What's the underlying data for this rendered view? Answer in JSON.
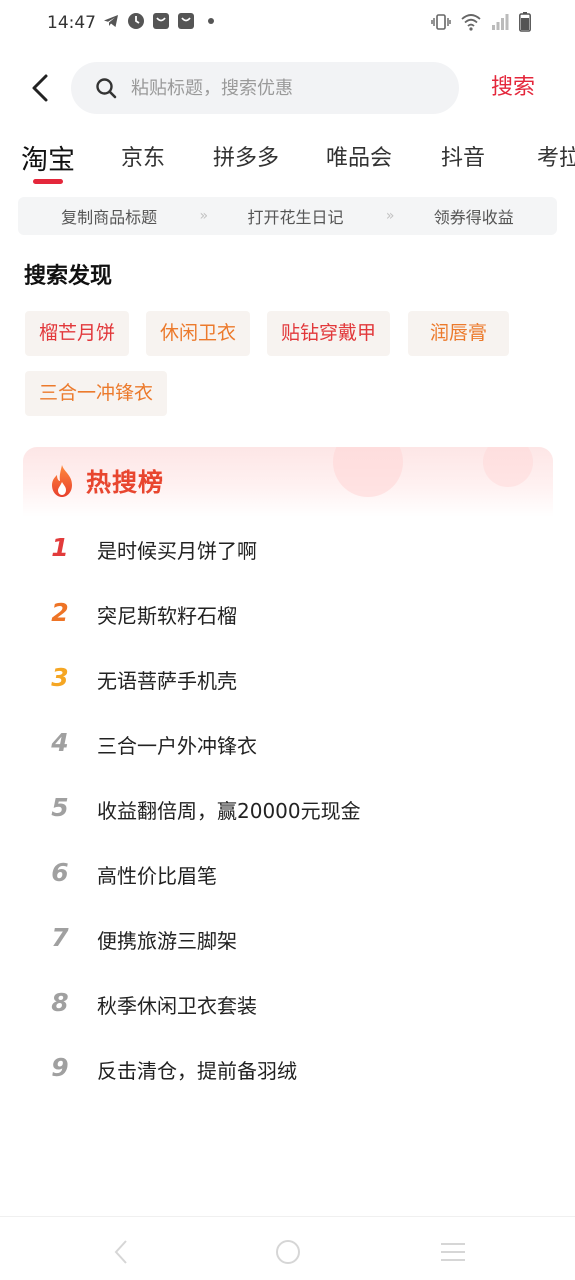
{
  "status_bar": {
    "time": "14:47"
  },
  "search": {
    "placeholder": "粘贴标题，搜索优惠",
    "button_label": "搜索"
  },
  "tabs": [
    {
      "label": "淘宝",
      "active": true
    },
    {
      "label": "京东"
    },
    {
      "label": "拼多多"
    },
    {
      "label": "唯品会"
    },
    {
      "label": "抖音"
    },
    {
      "label": "考拉"
    }
  ],
  "steps": [
    "复制商品标题",
    "打开花生日记",
    "领券得收益"
  ],
  "step_separator": "»",
  "discover": {
    "title": "搜索发现",
    "tags": [
      "榴芒月饼",
      "休闲卫衣",
      "贴钻穿戴甲",
      "润唇膏",
      "三合一冲锋衣"
    ]
  },
  "hot": {
    "title": "热搜榜",
    "items": [
      {
        "rank": "1",
        "text": "是时候买月饼了啊"
      },
      {
        "rank": "2",
        "text": "突尼斯软籽石榴"
      },
      {
        "rank": "3",
        "text": "无语菩萨手机壳"
      },
      {
        "rank": "4",
        "text": "三合一户外冲锋衣"
      },
      {
        "rank": "5",
        "text": "收益翻倍周，赢20000元现金"
      },
      {
        "rank": "6",
        "text": "高性价比眉笔"
      },
      {
        "rank": "7",
        "text": "便携旅游三脚架"
      },
      {
        "rank": "8",
        "text": "秋季休闲卫衣套装"
      },
      {
        "rank": "9",
        "text": "反击清仓，提前备羽绒"
      }
    ]
  },
  "colors": {
    "accent": "#e4273b",
    "rank1": "#e23b3b",
    "rank2": "#ee7426",
    "rank3": "#f5a623",
    "rank_other": "#a0a0a0"
  }
}
